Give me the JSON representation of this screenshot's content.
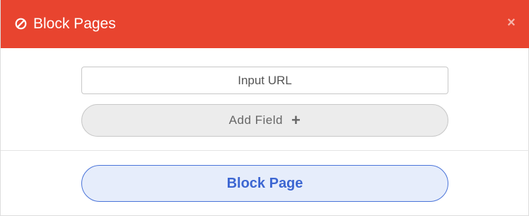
{
  "header": {
    "title": "Block Pages",
    "title_icon": "ban-icon",
    "close_icon": "×",
    "background_color": "#e8442f"
  },
  "form": {
    "url_placeholder": "Input URL",
    "url_value": "",
    "add_field_label": "Add Field",
    "add_field_icon": "+"
  },
  "footer": {
    "block_button_label": "Block Page",
    "accent_color": "#3c66d2"
  }
}
